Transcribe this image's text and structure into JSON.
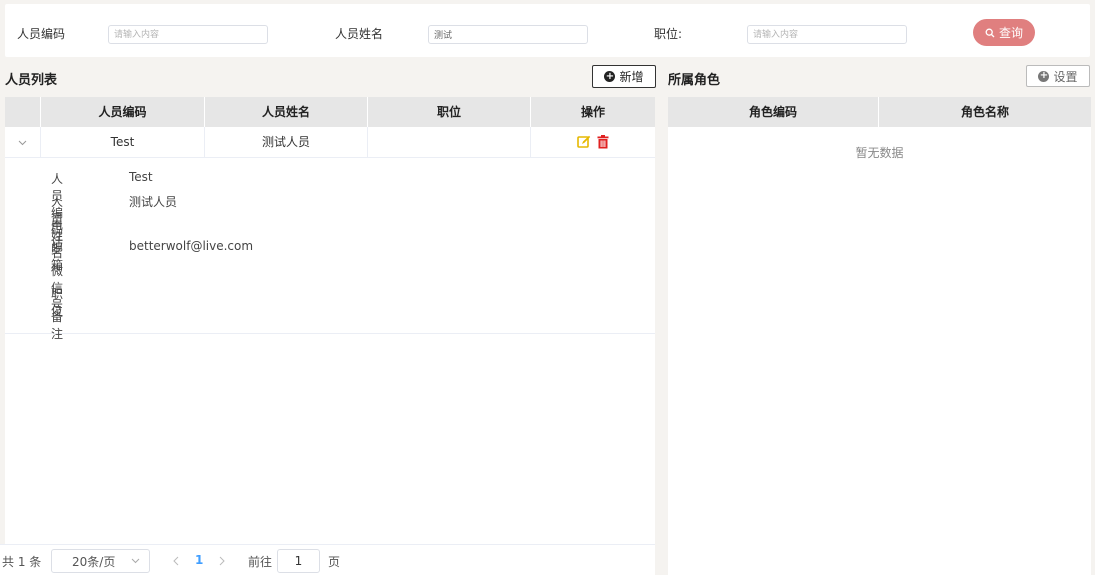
{
  "search": {
    "code_label": "人员编码",
    "code_placeholder": "请输入内容",
    "code_value": "",
    "name_label": "人员姓名",
    "name_placeholder": "请输入内容",
    "name_value": "测试",
    "position_label": "职位:",
    "position_placeholder": "请输入内容",
    "position_value": "",
    "query_label": "查询",
    "query_color": "#e07f7f"
  },
  "staff": {
    "title": "人员列表",
    "add_label": "新增",
    "columns": [
      "人员编码",
      "人员姓名",
      "职位",
      "操作"
    ],
    "rows": [
      {
        "code": "Test",
        "name": "测试人员",
        "position": "",
        "edit_icon": "edit-icon",
        "delete_icon": "trash-icon"
      }
    ],
    "detail": [
      {
        "label": "人员编码",
        "value": "Test"
      },
      {
        "label": "人员姓名",
        "value": "测试人员"
      },
      {
        "label": "电话",
        "value": ""
      },
      {
        "label": "邮箱",
        "value": "betterwolf@live.com"
      },
      {
        "label": "微信号",
        "value": ""
      },
      {
        "label": "职位",
        "value": ""
      },
      {
        "label": "备注",
        "value": ""
      }
    ],
    "edit_color": "#e6b800",
    "delete_color": "#e02020"
  },
  "roles": {
    "title": "所属角色",
    "settings_label": "设置",
    "columns": [
      "角色编码",
      "角色名称"
    ],
    "empty": "暂无数据"
  },
  "pager": {
    "total": "共 1 条",
    "page_size": "20条/页",
    "current_page": "1",
    "goto_label": "前往",
    "goto_value": "1",
    "page_suffix": "页",
    "active_color": "#409eff"
  }
}
